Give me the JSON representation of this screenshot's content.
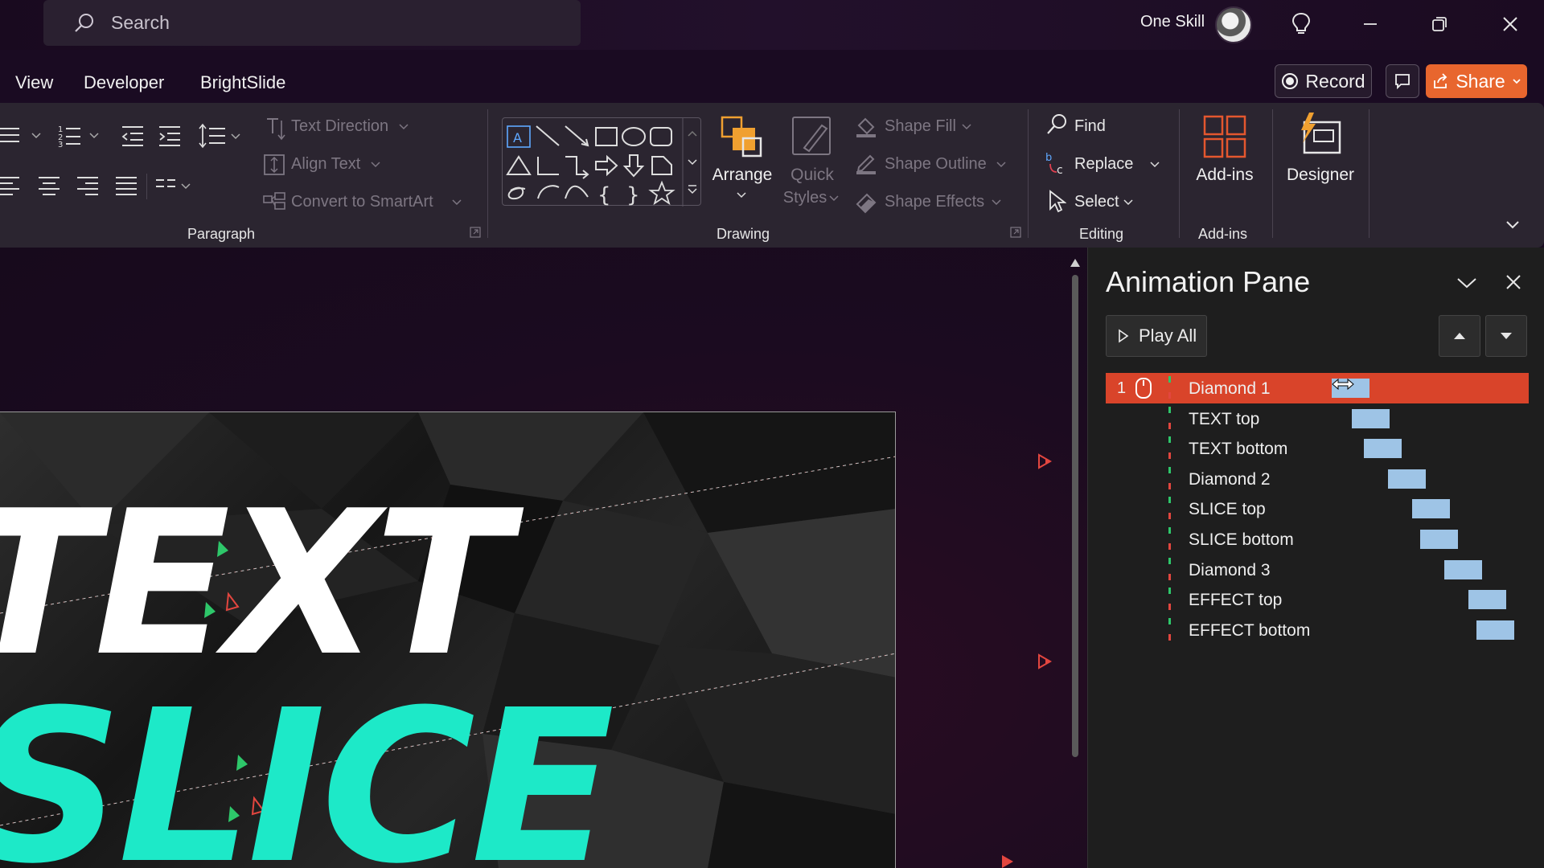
{
  "titlebar": {
    "search_placeholder": "Search",
    "user_name": "One Skill"
  },
  "menu": {
    "tabs": [
      "View",
      "Developer",
      "BrightSlide"
    ],
    "record_label": "Record",
    "share_label": "Share"
  },
  "ribbon": {
    "paragraph": {
      "text_direction": "Text Direction",
      "align_text": "Align Text",
      "convert_smartart": "Convert to SmartArt",
      "group_label": "Paragraph"
    },
    "drawing": {
      "arrange": "Arrange",
      "quick_styles_1": "Quick",
      "quick_styles_2": "Styles",
      "shape_fill": "Shape Fill",
      "shape_outline": "Shape Outline",
      "shape_effects": "Shape Effects",
      "group_label": "Drawing"
    },
    "editing": {
      "find": "Find",
      "replace": "Replace",
      "select": "Select",
      "group_label": "Editing"
    },
    "addins": {
      "addins_button": "Add-ins",
      "group_label": "Add-ins",
      "designer": "Designer"
    }
  },
  "slide": {
    "line1": "TEXT",
    "line2": "SLICE"
  },
  "animation_pane": {
    "title": "Animation Pane",
    "play_all": "Play All",
    "items": [
      {
        "number": "1",
        "name": "Diamond 1",
        "selected": true,
        "timeline_offset": 0.0
      },
      {
        "number": "",
        "name": "TEXT top",
        "selected": false,
        "timeline_offset": 0.1
      },
      {
        "number": "",
        "name": "TEXT bottom",
        "selected": false,
        "timeline_offset": 0.16
      },
      {
        "number": "",
        "name": "Diamond 2",
        "selected": false,
        "timeline_offset": 0.28
      },
      {
        "number": "",
        "name": "SLICE top",
        "selected": false,
        "timeline_offset": 0.4
      },
      {
        "number": "",
        "name": "SLICE bottom",
        "selected": false,
        "timeline_offset": 0.44
      },
      {
        "number": "",
        "name": "Diamond 3",
        "selected": false,
        "timeline_offset": 0.56
      },
      {
        "number": "",
        "name": "EFFECT top",
        "selected": false,
        "timeline_offset": 0.68
      },
      {
        "number": "",
        "name": "EFFECT bottom",
        "selected": false,
        "timeline_offset": 0.72
      }
    ]
  },
  "colors": {
    "accent_share": "#e8662e",
    "selected_row": "#d9442a",
    "timeline_bar": "#9ec4e6",
    "slice_text": "#1de9c8"
  }
}
